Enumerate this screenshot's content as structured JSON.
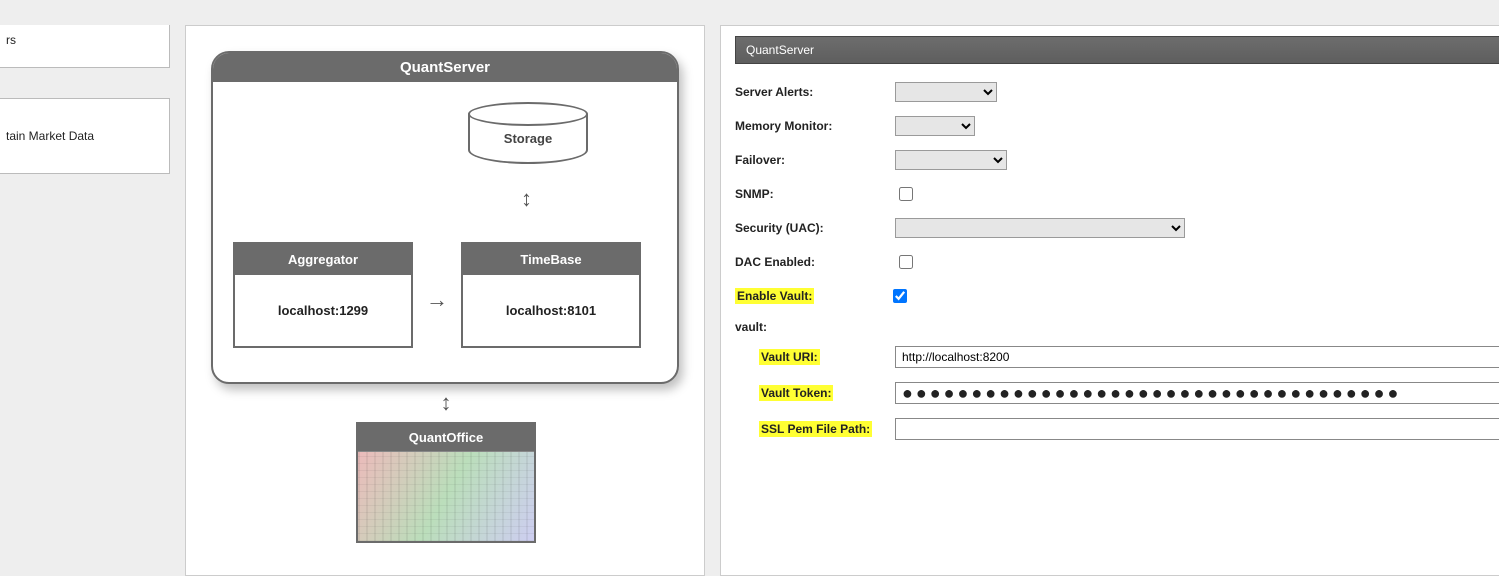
{
  "left": {
    "frag1": "rs",
    "frag2": "tain Market Data"
  },
  "diagram": {
    "server_title": "QuantServer",
    "storage_label": "Storage",
    "aggregator": {
      "title": "Aggregator",
      "addr": "localhost:1299"
    },
    "timebase": {
      "title": "TimeBase",
      "addr": "localhost:8101"
    },
    "quantoffice_title": "QuantOffice"
  },
  "panel": {
    "title": "QuantServer",
    "labels": {
      "server_alerts": "Server Alerts:",
      "memory_monitor": "Memory Monitor:",
      "failover": "Failover:",
      "snmp": "SNMP:",
      "security_uac": "Security (UAC):",
      "dac_enabled": "DAC Enabled:",
      "enable_vault": "Enable Vault:",
      "vault_group": "vault:",
      "vault_uri": "Vault URI:",
      "vault_token": "Vault Token:",
      "ssl_pem": "SSL Pem File Path:"
    },
    "values": {
      "server_alerts": "",
      "memory_monitor": "",
      "failover": "",
      "snmp_checked": false,
      "security_uac": "",
      "dac_checked": false,
      "enable_vault_checked": true,
      "vault_uri": "http://localhost:8200",
      "vault_token_mask": "●●●●●●●●●●●●●●●●●●●●●●●●●●●●●●●●●●●●",
      "ssl_pem": ""
    }
  }
}
